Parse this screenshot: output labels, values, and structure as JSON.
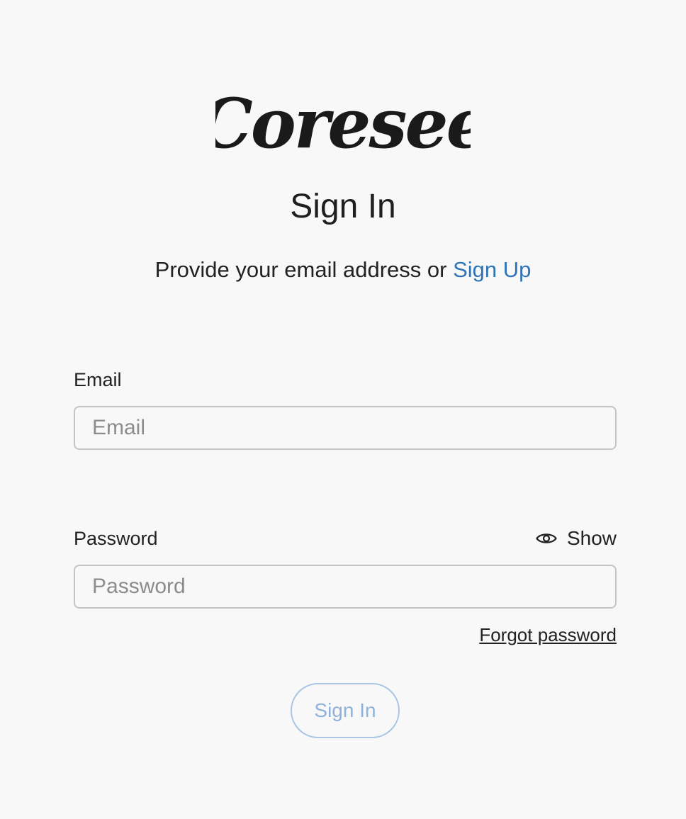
{
  "brand": {
    "logo_text": "Coresee",
    "logo_color": "#1a1a1a"
  },
  "header": {
    "title": "Sign In",
    "subtitle_prefix": "Provide your email address or",
    "signup_link": "Sign Up"
  },
  "form": {
    "email": {
      "label": "Email",
      "placeholder": "Email",
      "value": ""
    },
    "password": {
      "label": "Password",
      "placeholder": "Password",
      "value": "",
      "toggle_label": "Show",
      "toggle_icon": "eye-icon"
    },
    "forgot_label": "Forgot password",
    "submit_label": "Sign In"
  },
  "colors": {
    "link": "#2f74b8",
    "button_border": "#a9c4e4",
    "button_text": "#8fb1da",
    "background": "#f8f8f8",
    "input_border": "#c4c4c4"
  }
}
